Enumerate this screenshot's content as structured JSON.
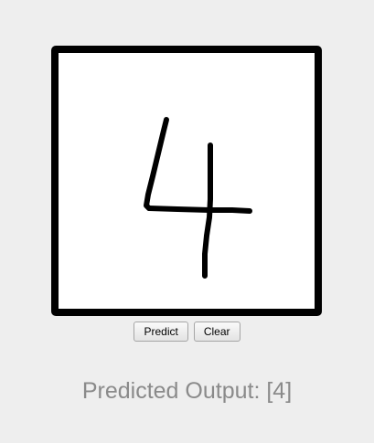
{
  "drawing_canvas": {
    "label": "",
    "stroke_color": "#000000",
    "background_color": "#ffffff",
    "border_color": "#000000"
  },
  "toolbar": {
    "predict_label": "Predict",
    "clear_label": "Clear"
  },
  "result": {
    "output_text": "Predicted Output: [4]",
    "text_color": "#8a8a8a"
  }
}
